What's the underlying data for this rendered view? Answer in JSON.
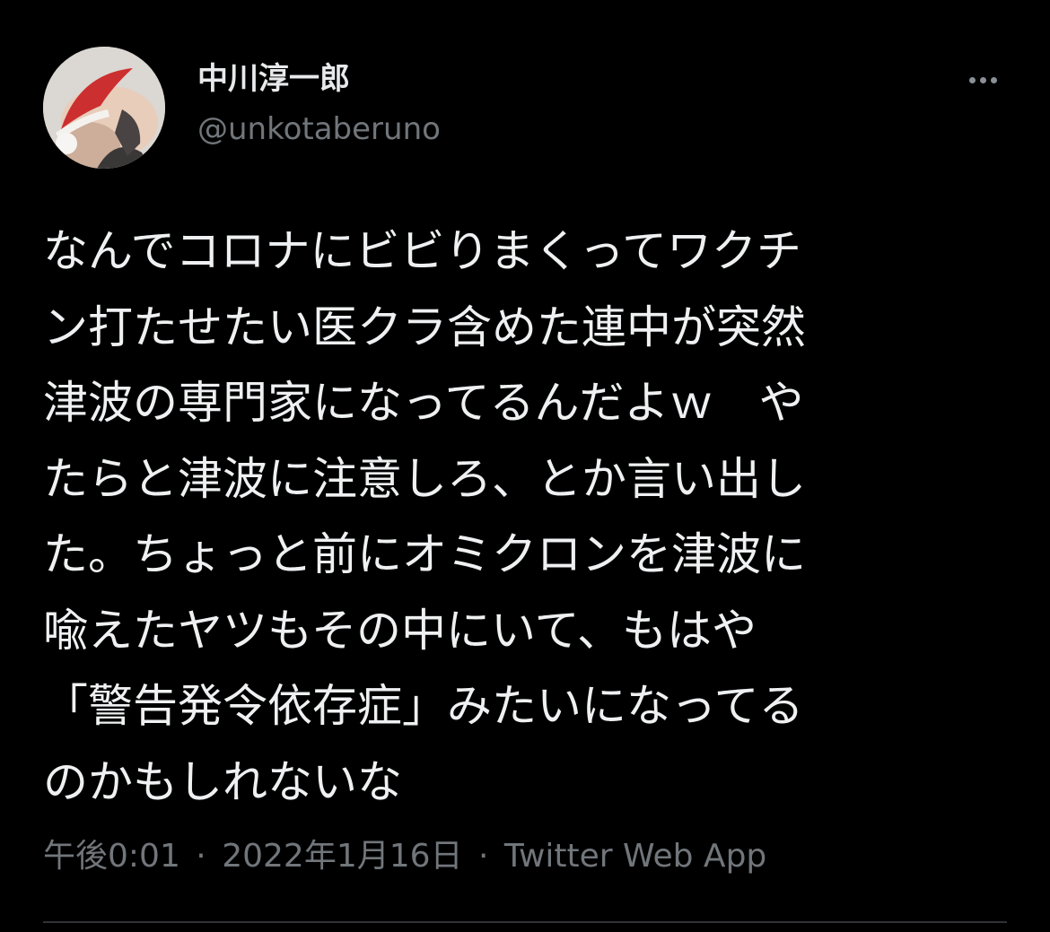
{
  "author": {
    "display_name": "中川淳一郎",
    "handle": "@unkotaberuno",
    "avatar_icon": "avatar-photo-santa-hat"
  },
  "more_icon": "more-horizontal-icon",
  "tweet": {
    "lines": [
      "なんでコロナにビビりまくってワクチ",
      "ン打たせたい医クラ含めた連中が突然",
      "津波の専門家になってるんだよｗ　や",
      "たらと津波に注意しろ、とか言い出し",
      "た。ちょっと前にオミクロンを津波に",
      "喩えたヤツもその中にいて、もはや",
      "「警告発令依存症」みたいになってる",
      "のかもしれないな"
    ]
  },
  "meta": {
    "time": "午後0:01",
    "separator": "·",
    "date": "2022年1月16日",
    "source": "Twitter Web App"
  },
  "colors": {
    "background": "#000000",
    "text_primary": "#e7e9ea",
    "text_secondary": "#71767b",
    "divider": "#2f3336"
  }
}
